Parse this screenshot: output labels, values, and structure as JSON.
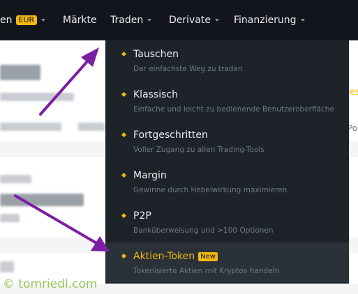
{
  "nav": {
    "items": [
      {
        "label": "en",
        "badge": "EUR"
      },
      {
        "label": "Märkte"
      },
      {
        "label": "Traden"
      },
      {
        "label": "Derivate"
      },
      {
        "label": "Finanzierung"
      }
    ]
  },
  "dropdown": {
    "items": [
      {
        "title": "Tauschen",
        "subtitle": "Der einfachste Weg zu traden"
      },
      {
        "title": "Klassisch",
        "subtitle": "Einfache und leicht zu bedienende Benutzeroberfläche"
      },
      {
        "title": "Fortgeschritten",
        "subtitle": "Voller Zugang zu allen Trading-Tools"
      },
      {
        "title": "Margin",
        "subtitle": "Gewinne durch Hebelwirkung maximieren"
      },
      {
        "title": "P2P",
        "subtitle": "Banküberweisung und >100 Optionen"
      },
      {
        "title": "Aktien-Token",
        "badge": "New",
        "subtitle": "Tokenisierte Aktien mit Kryptos handeln"
      }
    ]
  },
  "page": {
    "peek_link": "es",
    "peek_text": "Po"
  },
  "colors": {
    "accent": "#f0b90b",
    "arrow": "#7b1fa2",
    "topbar": "#12161c",
    "menu": "#1e2329"
  },
  "watermark": "© tomriedl.com"
}
